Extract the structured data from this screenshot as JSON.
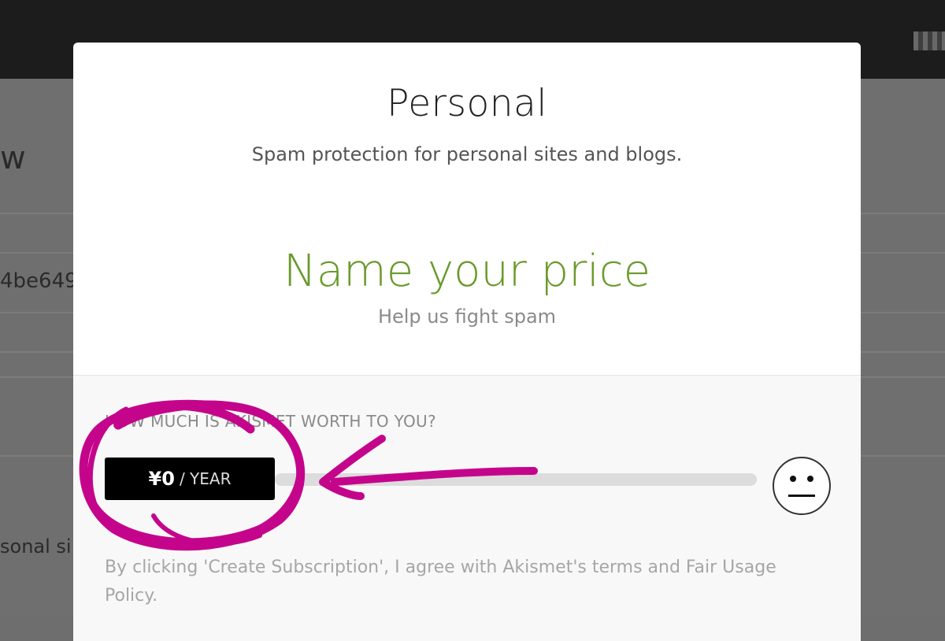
{
  "background": {
    "heading_fragment": "w",
    "key_fragment": "4be649",
    "desc_fragment": "sonal si"
  },
  "modal": {
    "plan_title": "Personal",
    "plan_subtitle": "Spam protection for personal sites and blogs.",
    "name_price_title": "Name your price",
    "name_price_subtitle": "Help us fight spam",
    "worth_question": "HOW MUCH IS AKISMET WORTH TO YOU?",
    "price_amount": "¥0",
    "price_unit": "/ YEAR",
    "slider_fraction": 0,
    "face_icon": "neutral-face-icon",
    "terms_text": "By clicking 'Create Subscription', I agree with Akismet's terms and Fair Usage Policy."
  },
  "colors": {
    "accent_green": "#6a9a2b",
    "annotation_magenta": "#c4058c"
  }
}
